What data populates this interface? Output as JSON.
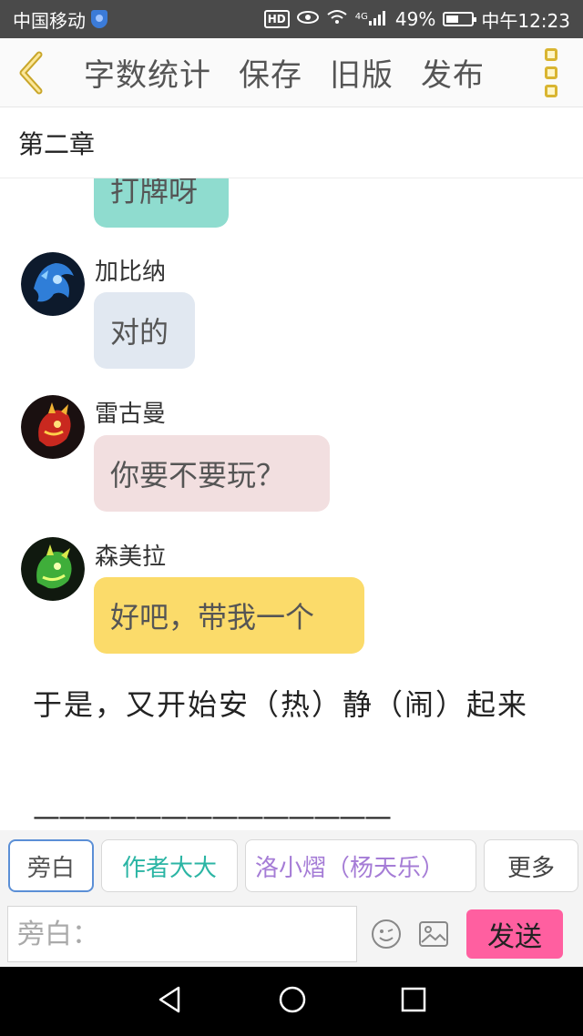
{
  "status": {
    "carrier": "中国移动",
    "hd": "HD",
    "network": "4G",
    "battery": "49%",
    "battery_level": 0.49,
    "time": "中午12:23"
  },
  "toolbar": {
    "word_count": "字数统计",
    "save": "保存",
    "old_version": "旧版",
    "publish": "发布"
  },
  "chapter": {
    "title": "第二章"
  },
  "messages": [
    {
      "sender": "",
      "text": "打牌呀",
      "color": "#8fdccf"
    },
    {
      "sender": "加比纳",
      "text": "对的",
      "color": "#e1e8f1"
    },
    {
      "sender": "雷古曼",
      "text": "你要不要玩？",
      "color": "#f2dfe0"
    },
    {
      "sender": "森美拉",
      "text": "好吧，带我一个",
      "color": "#fbdb6a"
    }
  ],
  "narration": {
    "text": "于是，又开始安（热）静（闹）起来",
    "divider": "——————————————"
  },
  "roles": {
    "narrator": "旁白",
    "author": "作者大大",
    "character": "洛小熠（杨天乐）",
    "more": "更多"
  },
  "input": {
    "placeholder": "旁白：",
    "send": "发送"
  }
}
